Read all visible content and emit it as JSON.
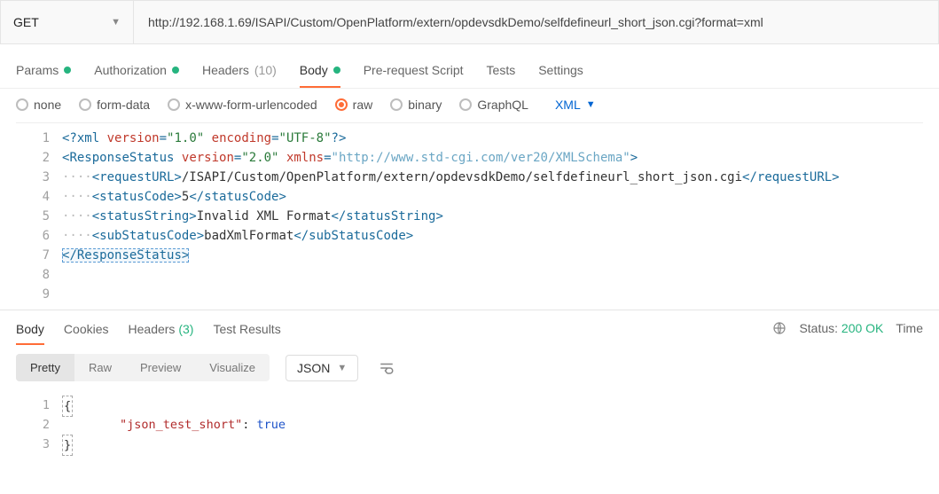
{
  "request": {
    "method": "GET",
    "url": "http://192.168.1.69/ISAPI/Custom/OpenPlatform/extern/opdevsdkDemo/selfdefineurl_short_json.cgi?format=xml"
  },
  "tabs": {
    "params": {
      "label": "Params",
      "dot": true
    },
    "authorization": {
      "label": "Authorization",
      "dot": true
    },
    "headers": {
      "label": "Headers",
      "count": "(10)"
    },
    "body": {
      "label": "Body",
      "dot": true
    },
    "pre": {
      "label": "Pre-request Script"
    },
    "tests": {
      "label": "Tests"
    },
    "settings": {
      "label": "Settings"
    }
  },
  "bodyTypes": {
    "none": "none",
    "formdata": "form-data",
    "xwww": "x-www-form-urlencoded",
    "raw": "raw",
    "binary": "binary",
    "graphql": "GraphQL"
  },
  "format": {
    "name": "XML"
  },
  "reqBody": {
    "l1": {
      "pi_open": "<?",
      "pi_name": "xml",
      "sp": " ",
      "attr1": "version",
      "eq": "=",
      "val1": "\"1.0\"",
      "attr2": "encoding",
      "val2": "\"UTF-8\"",
      "pi_close": "?>"
    },
    "l2": {
      "open_l": "<",
      "name": "ResponseStatus",
      "attr1": "version",
      "val1": "\"2.0\"",
      "attr2": "xmlns",
      "val2": "\"http://www.std-cgi.com/ver20/XMLSchema\"",
      "open_r": ">"
    },
    "l3": {
      "dots": "····",
      "open": "<requestURL>",
      "text": "/ISAPI/Custom/OpenPlatform/extern/opdevsdkDemo/selfdefineurl_short_json.cgi",
      "close": "</requestURL>"
    },
    "l4": {
      "dots": "····",
      "open": "<statusCode>",
      "text": "5",
      "close": "</statusCode>"
    },
    "l5": {
      "dots": "····",
      "open": "<statusString>",
      "text": "Invalid XML Format",
      "close": "</statusString>"
    },
    "l6": {
      "dots": "····",
      "open": "<subStatusCode>",
      "text": "badXmlFormat",
      "close": "</subStatusCode>"
    },
    "l7": {
      "close_l": "<",
      "slash": "/",
      "name": "ResponseStatus",
      "gt": ">"
    }
  },
  "lines": {
    "1": "1",
    "2": "2",
    "3": "3",
    "4": "4",
    "5": "5",
    "6": "6",
    "7": "7",
    "8": "8",
    "9": "9"
  },
  "response": {
    "tabs": {
      "body": "Body",
      "cookies": "Cookies",
      "headers": "Headers",
      "headersCount": "(3)",
      "tests": "Test Results"
    },
    "status": {
      "label": "Status:",
      "code": "200 OK"
    },
    "time": "Time",
    "view": {
      "pretty": "Pretty",
      "raw": "Raw",
      "preview": "Preview",
      "visualize": "Visualize"
    },
    "format": "JSON",
    "body": {
      "l1": "{",
      "l2_indent": "        ",
      "l2_key": "\"json_test_short\"",
      "l2_colon": ": ",
      "l2_val": "true",
      "l3": "}"
    },
    "lines": {
      "1": "1",
      "2": "2",
      "3": "3"
    }
  }
}
